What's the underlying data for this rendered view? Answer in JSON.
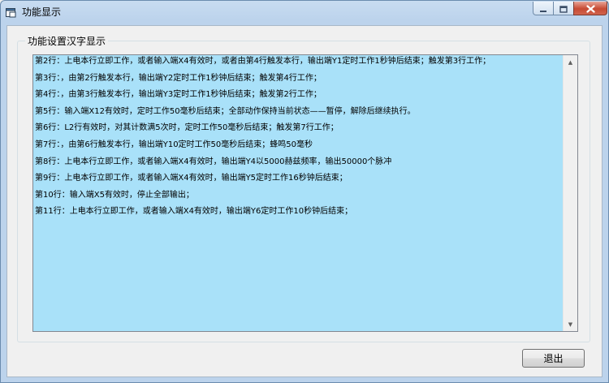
{
  "window": {
    "title": "功能显示"
  },
  "group": {
    "label": "功能设置汉字显示"
  },
  "lines": [
    "第2行：上电本行立即工作，或者输入端X4有效时，或者由第4行触发本行，输出端Y1定时工作1秒钟后结束；触发第3行工作；",
    "第3行：，由第2行触发本行，输出端Y2定时工作1秒钟后结束；触发第4行工作；",
    "第4行：，由第3行触发本行，输出端Y3定时工作1秒钟后结束；触发第2行工作；",
    "第5行：输入端X12有效时，定时工作50毫秒后结束；全部动作保持当前状态——暂停，解除后继续执行。",
    "第6行：L2行有效时，对其计数满5次时，定时工作50毫秒后结束；触发第7行工作；",
    "第7行：，由第6行触发本行，输出端Y10定时工作50毫秒后结束；蜂鸣50毫秒",
    "第8行：上电本行立即工作，或者输入端X4有效时，输出端Y4以5000赫兹频率，输出50000个脉冲",
    "第9行：上电本行立即工作，或者输入端X4有效时，输出端Y5定时工作16秒钟后结束；",
    "第10行：输入端X5有效时，停止全部输出；",
    "第11行：上电本行立即工作，或者输入端X4有效时，输出端Y6定时工作10秒钟后结束；"
  ],
  "buttons": {
    "exit": "退出"
  },
  "icons": {
    "app": "window-app-icon",
    "minimize": "minimize-icon",
    "maximize": "maximize-icon",
    "close": "close-icon",
    "scroll_up": "scroll-up-arrow-icon",
    "scroll_down": "scroll-down-arrow-icon"
  },
  "colors": {
    "textarea_bg": "#a9e1f9",
    "close_button": "#c74a33"
  }
}
